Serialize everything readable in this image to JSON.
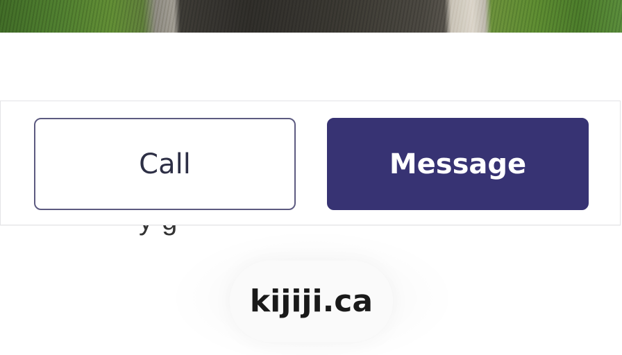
{
  "actions": {
    "call_label": "Call",
    "message_label": "Message"
  },
  "footer": {
    "domain_label": "kijiji.ca"
  },
  "partial_text": "y g",
  "colors": {
    "primary": "#373373",
    "call_border": "#5c5a80",
    "text_dark": "#2d2f45"
  }
}
